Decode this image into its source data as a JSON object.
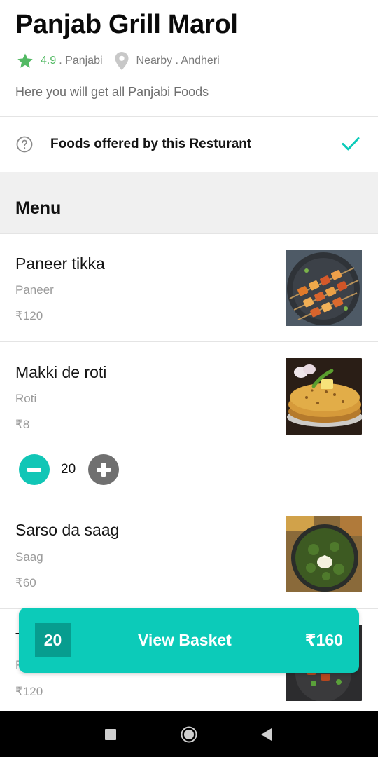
{
  "header": {
    "title": "Panjab Grill Marol",
    "rating": "4.9",
    "cuisine": ". Panjabi",
    "location": "Nearby . Andheri",
    "description": "Here you will get all Panjabi Foods"
  },
  "offered": {
    "label": "Foods offered by this Resturant"
  },
  "menu": {
    "title": "Menu",
    "items": [
      {
        "name": "Paneer tikka",
        "category": "Paneer",
        "price": "₹120"
      },
      {
        "name": "Makki de roti",
        "category": "Roti",
        "price": "₹8",
        "quantity": "20"
      },
      {
        "name": "Sarso da saag",
        "category": "Saag",
        "price": "₹60"
      },
      {
        "name": "T",
        "category": "P",
        "price": "₹120"
      }
    ]
  },
  "basket": {
    "count": "20",
    "label": "View Basket",
    "total": "₹160"
  },
  "colors": {
    "accent": "#0ccbb9",
    "accent_dark": "#079d8f",
    "rating_green": "#52b963",
    "muted_text": "#9a9a9a"
  },
  "icons": {
    "rating": "star-icon",
    "location": "location-pin-icon",
    "help": "question-circle-icon",
    "check": "check-icon",
    "decrease": "minus-icon",
    "increase": "plus-icon"
  }
}
